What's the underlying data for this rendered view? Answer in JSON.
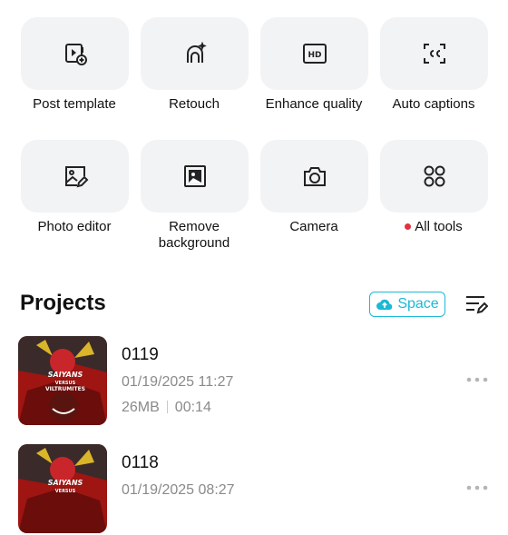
{
  "tools": [
    {
      "label": "Post template",
      "icon": "post-template-icon"
    },
    {
      "label": "Retouch",
      "icon": "retouch-icon"
    },
    {
      "label": "Enhance quality",
      "icon": "hd-icon"
    },
    {
      "label": "Auto captions",
      "icon": "captions-icon"
    },
    {
      "label": "Photo editor",
      "icon": "photo-editor-icon"
    },
    {
      "label_line1": "Remove",
      "label_line2": "background",
      "icon": "remove-background-icon"
    },
    {
      "label": "Camera",
      "icon": "camera-icon"
    },
    {
      "label": "All tools",
      "icon": "all-tools-icon",
      "badge_color": "#e0323f"
    }
  ],
  "projects_section": {
    "title": "Projects",
    "space_label": "Space",
    "accent": "#1bb9d6"
  },
  "projects": [
    {
      "name": "0119",
      "date": "01/19/2025 11:27",
      "size": "26MB",
      "duration": "00:14",
      "thumb_text": "SAIYANS VERSUS VILTRUMITES"
    },
    {
      "name": "0118",
      "date": "01/19/2025 08:27",
      "thumb_text": "SAIYANS VERSUS"
    }
  ]
}
